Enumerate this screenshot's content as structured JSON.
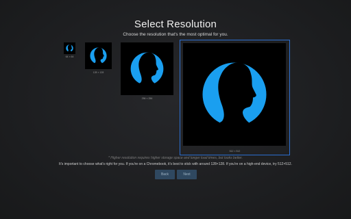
{
  "header": {
    "title": "Select Resolution",
    "subtitle": "Choose the resolution that's the most optimal for you."
  },
  "options": [
    {
      "label": "64 × 64",
      "icon": "profile-silhouette-icon"
    },
    {
      "label": "128 × 128",
      "icon": "profile-silhouette-icon"
    },
    {
      "label": "256 × 256",
      "icon": "profile-silhouette-icon"
    },
    {
      "label": "512 × 512",
      "icon": "profile-silhouette-icon",
      "selected": true
    }
  ],
  "footer": {
    "note": "* Higher resolution requires higher storage space and longer load times, but looks better.",
    "tip": "It's important to choose what's right for you. If you're on a Chromebook, it's best to stick with around 128×128. If you're on a high-end device, try 512×512."
  },
  "buttons": {
    "back": "Back",
    "next": "Next"
  },
  "colors": {
    "background": "#1e1f21",
    "accent": "#1a9ff0",
    "selection_border": "#2c6fd1",
    "button": "#2f4860"
  }
}
